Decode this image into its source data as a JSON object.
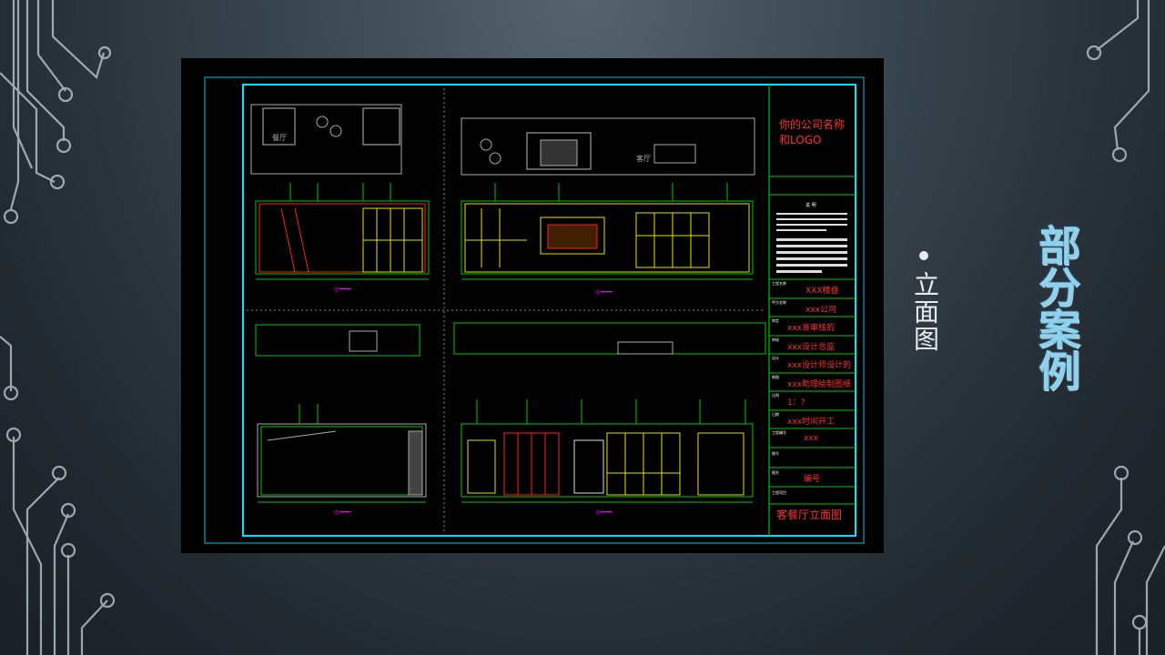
{
  "slide": {
    "title": "部分案例",
    "bullet_text": "立面图"
  },
  "drawing": {
    "company": "你的公司名称和LOGO",
    "company_line1": "你的公司名称",
    "company_line2": "和LOGO",
    "notes_heading": "说　明",
    "fields": [
      {
        "label": "工程名称",
        "value": "XXX楼盘"
      },
      {
        "label": "甲方名称",
        "value": "xxx公司"
      },
      {
        "label": "审定",
        "value": "xxx准审核的"
      },
      {
        "label": "审核",
        "value": "xxx设计总监"
      },
      {
        "label": "设计",
        "value": "xxx设计师设计的"
      },
      {
        "label": "制图",
        "value": "xxx助理绘制图纸"
      },
      {
        "label": "比例",
        "value": "1：?"
      },
      {
        "label": "日期",
        "value": "xxx时间开工"
      },
      {
        "label": "工程编号",
        "value": "xxx"
      },
      {
        "label": "图号",
        "value": ""
      },
      {
        "label": "图名",
        "value": "编号"
      },
      {
        "label": "工程项目",
        "value": ""
      }
    ],
    "drawing_name": "客餐厅立面图",
    "plan_labels": [
      "餐厅",
      "客厅"
    ]
  },
  "colors": {
    "cyan": "#00e5ff",
    "green": "#00c800",
    "red": "#ff2020",
    "yellow": "#e8e000",
    "magenta": "#ff00ff",
    "title_blue": "#8fd2ee"
  }
}
